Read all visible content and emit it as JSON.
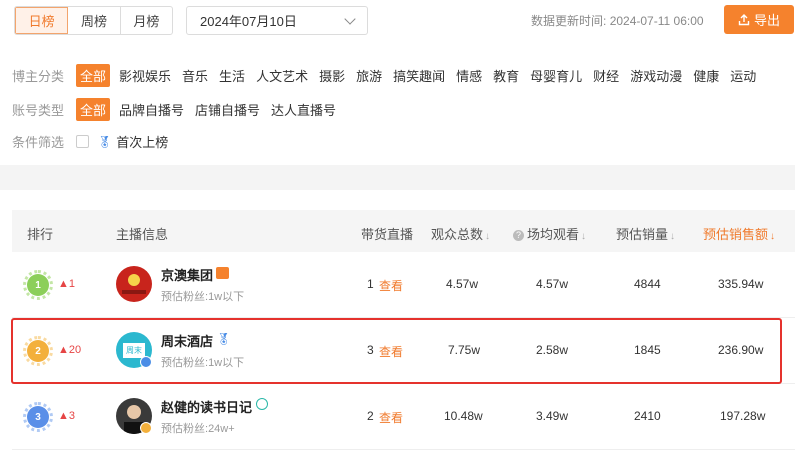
{
  "period_tabs": [
    "日榜",
    "周榜",
    "月榜"
  ],
  "date_value": "2024年07月10日",
  "update": {
    "label": "数据更新时间:",
    "value": "2024-07-11 06:00"
  },
  "export_label": "导出",
  "filters": {
    "category": {
      "label": "博主分类",
      "items": [
        "全部",
        "影视娱乐",
        "音乐",
        "生活",
        "人文艺术",
        "摄影",
        "旅游",
        "搞笑趣闻",
        "情感",
        "教育",
        "母婴育儿",
        "财经",
        "游戏动漫",
        "健康",
        "运动"
      ]
    },
    "account": {
      "label": "账号类型",
      "items": [
        "全部",
        "品牌自播号",
        "店铺自播号",
        "达人直播号"
      ]
    },
    "condition": {
      "label": "条件筛选",
      "option": "首次上榜"
    }
  },
  "columns": {
    "rank": "排行",
    "info": "主播信息",
    "live": "带货直播",
    "viewers": "观众总数",
    "avg_watch": "场均观看",
    "sales": "预估销量",
    "revenue": "预估销售额",
    "sort_mark": "↓"
  },
  "fans_label": "预估粉丝:",
  "view_label": "查看",
  "rows": [
    {
      "rank": "1",
      "change": "▲1",
      "name": "京澳集团",
      "fans": "1w以下",
      "live": "1",
      "viewers": "4.57w",
      "avg": "4.57w",
      "sales": "4844",
      "revenue": "335.94w"
    },
    {
      "rank": "2",
      "change": "▲20",
      "name": "周末酒店",
      "fans": "1w以下",
      "live": "3",
      "viewers": "7.75w",
      "avg": "2.58w",
      "sales": "1845",
      "revenue": "236.90w",
      "avatar_text": "周末"
    },
    {
      "rank": "3",
      "change": "▲3",
      "name": "赵健的读书日记",
      "fans": "24w+",
      "live": "2",
      "viewers": "10.48w",
      "avg": "3.49w",
      "sales": "2410",
      "revenue": "197.28w"
    }
  ],
  "colors": {
    "accent": "#f5822d",
    "highlight": "#e5322d",
    "up": "#e64545"
  }
}
